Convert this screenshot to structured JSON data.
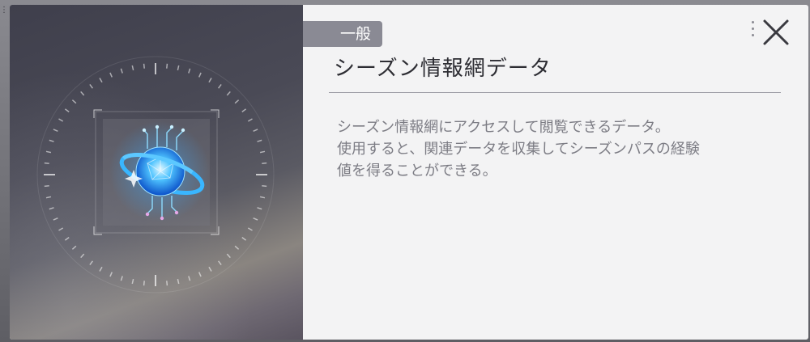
{
  "item": {
    "category": "一般",
    "name": "シーズン情報網データ",
    "description_lines": [
      "シーズン情報網にアクセスして閲覧できるデータ。",
      "使用すると、関連データを収集してシーズンパスの経験",
      "値を得ることができる。"
    ]
  },
  "icons": {
    "close": "close-icon",
    "item": "data-orb-icon",
    "drag": "drag-handle-icon"
  },
  "colors": {
    "panel_bg": "#f3f3f4",
    "tab_bg": "#8a8a94",
    "title_text": "#2d2d33",
    "desc_text": "#7c7c84",
    "orb_glow": "#1ea0ff"
  }
}
